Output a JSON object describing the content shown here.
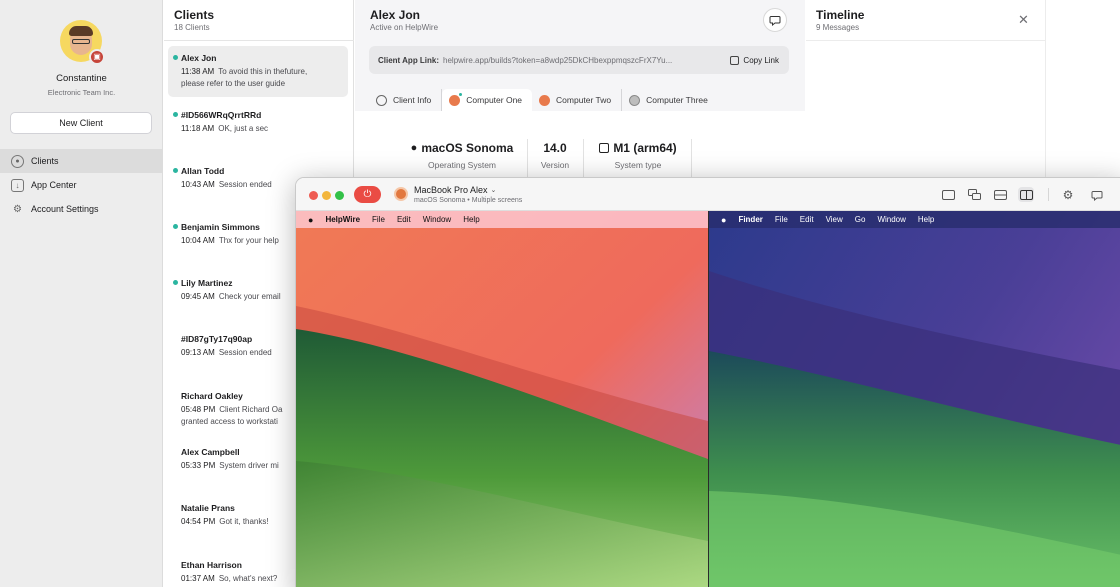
{
  "user": {
    "name": "Constantine",
    "company": "Electronic Team Inc."
  },
  "sidebar": {
    "new_client_label": "New Client",
    "items": [
      {
        "label": "Clients"
      },
      {
        "label": "App Center"
      },
      {
        "label": "Account Settings"
      }
    ]
  },
  "clients": {
    "title": "Clients",
    "count": "18 Clients",
    "items": [
      {
        "name": "Alex Jon",
        "time": "11:38 AM",
        "message": "To avoid this in thefuture,",
        "extra": "please refer to the user guide",
        "online": true
      },
      {
        "name": "#ID566WRqQrrtRRd",
        "time": "11:18 AM",
        "message": "OK, just a sec",
        "extra": "",
        "online": true
      },
      {
        "name": "Allan Todd",
        "time": "10:43 AM",
        "message": "Session ended",
        "extra": "",
        "online": true
      },
      {
        "name": "Benjamin Simmons",
        "time": "10:04 AM",
        "message": "Thx for your help",
        "extra": "",
        "online": true
      },
      {
        "name": "Lily Martinez",
        "time": "09:45 AM",
        "message": "Check your email",
        "extra": "",
        "online": true
      },
      {
        "name": "#ID87gTy17q90ap",
        "time": "09:13 AM",
        "message": "Session ended",
        "extra": "",
        "online": false
      },
      {
        "name": "Richard Oakley",
        "time": "05:48 PM",
        "message": "Client Richard Oa",
        "extra": "granted access to workstati",
        "online": false
      },
      {
        "name": "Alex Campbell",
        "time": "05:33 PM",
        "message": "System driver mi",
        "extra": "",
        "online": false
      },
      {
        "name": "Natalie Prans",
        "time": "04:54 PM",
        "message": "Got it, thanks!",
        "extra": "",
        "online": false
      },
      {
        "name": "Ethan Harrison",
        "time": "01:37 AM",
        "message": "So, what's next?",
        "extra": "",
        "online": false
      }
    ]
  },
  "detail": {
    "name": "Alex Jon",
    "status": "Active on HelpWire",
    "link_label": "Client App Link:",
    "link_value": "helpwire.app/builds?token=a8wdp25DkCHbexppmqszcFrX7Yu...",
    "copy_label": "Copy Link",
    "tabs": [
      {
        "label": "Client Info"
      },
      {
        "label": "Computer One"
      },
      {
        "label": "Computer Two"
      },
      {
        "label": "Computer Three"
      }
    ],
    "specs": [
      {
        "value": "macOS Sonoma",
        "label": "Operating System"
      },
      {
        "value": "14.0",
        "label": "Version"
      },
      {
        "value": "M1 (arm64)",
        "label": "System type"
      }
    ]
  },
  "timeline": {
    "title": "Timeline",
    "count": "9 Messages"
  },
  "remote": {
    "machine_name": "MacBook Pro Alex",
    "machine_sub": "macOS Sonoma • Multiple screens",
    "left_menu": [
      "HelpWire",
      "File",
      "Edit",
      "Window",
      "Help"
    ],
    "right_menu": [
      "Finder",
      "File",
      "Edit",
      "View",
      "Go",
      "Window",
      "Help"
    ]
  },
  "colors": {
    "accent_teal": "#2bb5a0",
    "power_red": "#ea4c44",
    "sidebar_bg": "#ededed"
  }
}
